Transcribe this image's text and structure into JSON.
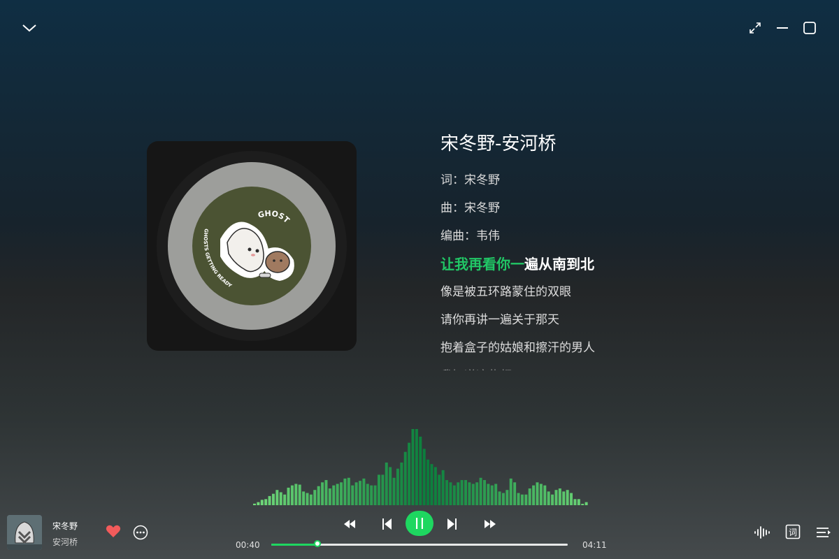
{
  "song": {
    "heading": "宋冬野-安河桥",
    "title": "宋冬野",
    "artist": "安河桥",
    "liked": true
  },
  "lyrics": {
    "lines": [
      "词：宋冬野",
      "曲：宋冬野",
      "编曲：韦伟"
    ],
    "current_sung": "让我再看你一",
    "current_rest": "遍从南到北",
    "upcoming": [
      "像是被五环路蒙住的双眼",
      "请你再讲一遍关于那天",
      "抱着盒子的姑娘和擦汗的男人",
      "我知道这些都"
    ]
  },
  "album_art": {
    "sticker_text_top": "GHOST",
    "sticker_text_side": "GHOSTS GETTING READY FOR SLEEP!"
  },
  "player": {
    "elapsed": "00:40",
    "duration": "04:11",
    "progress_fraction": 0.159,
    "state": "playing"
  },
  "visualizer": {
    "levels": [
      2,
      4,
      7,
      8,
      12,
      15,
      20,
      17,
      14,
      23,
      26,
      28,
      27,
      18,
      16,
      14,
      20,
      25,
      30,
      33,
      22,
      26,
      28,
      30,
      35,
      36,
      26,
      30,
      32,
      35,
      28,
      26,
      26,
      40,
      40,
      56,
      50,
      36,
      48,
      56,
      70,
      82,
      100,
      100,
      90,
      74,
      60,
      54,
      50,
      40,
      46,
      33,
      30,
      26,
      30,
      33,
      33,
      30,
      28,
      30,
      36,
      33,
      28,
      26,
      28,
      18,
      16,
      20,
      35,
      30,
      16,
      14,
      14,
      22,
      26,
      30,
      28,
      26,
      18,
      14,
      20,
      22,
      18,
      20,
      16,
      8,
      8,
      0,
      4
    ]
  },
  "colors": {
    "accent": "#1ed760",
    "lyric_active": "#21c766",
    "like": "#f25b5b"
  },
  "icons": {
    "collapse": "chevron-down-icon",
    "fullscreen": "expand-icon",
    "minimize": "minimize-icon",
    "maximize": "maximize-icon",
    "like": "heart-icon",
    "more": "more-icon",
    "rewind": "rewind-icon",
    "prev": "previous-icon",
    "play": "pause-icon",
    "next": "next-icon",
    "forward": "fast-forward-icon",
    "effects": "sound-effect-icon",
    "lyrics": "lyrics-icon",
    "playlist": "playlist-icon"
  }
}
